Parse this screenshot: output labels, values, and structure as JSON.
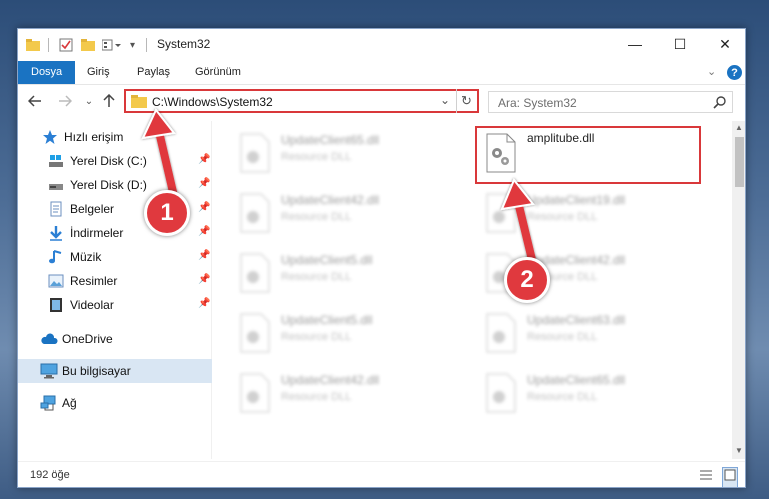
{
  "window": {
    "title": "System32",
    "controls": {
      "minimize": "—",
      "maximize": "☐",
      "close": "✕"
    }
  },
  "ribbon": {
    "tabs": [
      {
        "label": "Dosya"
      },
      {
        "label": "Giriş"
      },
      {
        "label": "Paylaş"
      },
      {
        "label": "Görünüm"
      }
    ]
  },
  "address": {
    "path": "C:\\Windows\\System32",
    "search_placeholder": "Ara: System32"
  },
  "sidebar": {
    "items": [
      {
        "label": "Hızlı erişim",
        "icon": "star-icon"
      },
      {
        "label": "Yerel Disk (C:)",
        "icon": "drive-icon",
        "pinned": true
      },
      {
        "label": "Yerel Disk (D:)",
        "icon": "drive-icon",
        "pinned": true
      },
      {
        "label": "Belgeler",
        "icon": "document-icon",
        "pinned": true
      },
      {
        "label": "İndirmeler",
        "icon": "download-icon",
        "pinned": true
      },
      {
        "label": "Müzik",
        "icon": "music-icon",
        "pinned": true
      },
      {
        "label": "Resimler",
        "icon": "pictures-icon",
        "pinned": true
      },
      {
        "label": "Videolar",
        "icon": "video-icon",
        "pinned": true
      },
      {
        "label": "OneDrive",
        "icon": "cloud-icon"
      },
      {
        "label": "Bu bilgisayar",
        "icon": "computer-icon",
        "selected": true
      },
      {
        "label": "Ağ",
        "icon": "network-icon"
      }
    ]
  },
  "files": {
    "left_column": [
      {
        "name": "UpdateClient65.dll",
        "type": "Resource DLL"
      },
      {
        "name": "UpdateClient42.dll",
        "type": "Resource DLL"
      },
      {
        "name": "UpdateClient5.dll",
        "type": "Resource DLL"
      },
      {
        "name": "UpdateClient5.dll",
        "type": "Resource DLL"
      },
      {
        "name": "UpdateClient42.dll",
        "type": "Resource DLL"
      }
    ],
    "right_column": [
      {
        "name": "amplitube.dll",
        "type": ""
      },
      {
        "name": "UpdateClient19.dll",
        "type": "Resource DLL"
      },
      {
        "name": "UpdateClient42.dll",
        "type": "Resource DLL"
      },
      {
        "name": "UpdateClient63.dll",
        "type": "Resource DLL"
      },
      {
        "name": "UpdateClient65.dll",
        "type": "Resource DLL"
      }
    ]
  },
  "status": {
    "count": "192 öğe"
  },
  "annotations": {
    "step1": "1",
    "step2": "2",
    "color": "#e0393e"
  }
}
